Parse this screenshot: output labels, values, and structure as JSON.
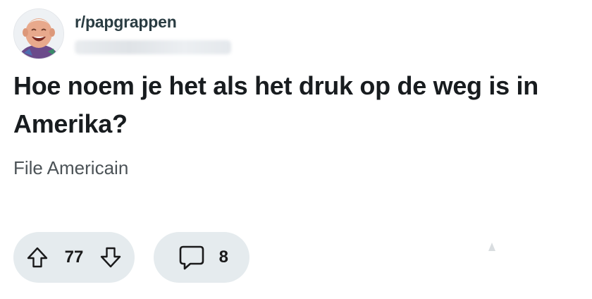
{
  "post": {
    "subreddit": "r/papgrappen",
    "title": "Hoe noem je het als het druk op de weg is in Amerika?",
    "body": "File Americain",
    "votes": "77",
    "comments": "8"
  },
  "icons": {
    "upvote": "arrow-up-icon",
    "downvote": "arrow-down-icon",
    "comment": "speech-bubble-icon"
  },
  "colors": {
    "pill_background": "#e5ebee",
    "title_text": "#181c1f",
    "body_text": "#4c5357"
  }
}
